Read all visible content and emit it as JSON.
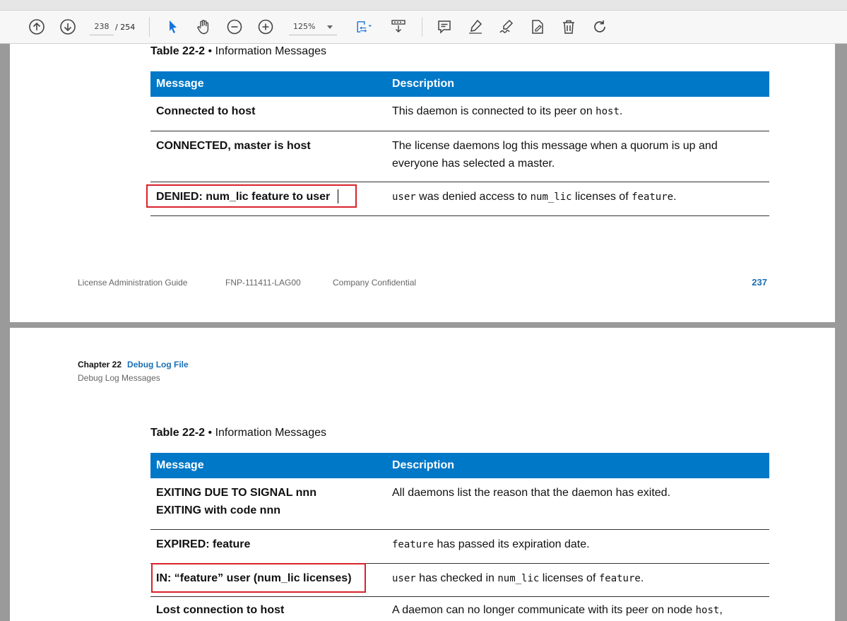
{
  "toolbar": {
    "current_page": "238",
    "total_pages": "/ 254",
    "zoom": "125%",
    "icons": [
      "prev-page-icon",
      "next-page-icon",
      "select-cursor-icon",
      "hand-tool-icon",
      "zoom-out-icon",
      "zoom-in-icon",
      "fit-page-icon",
      "scroll-mode-icon",
      "comment-icon",
      "highlight-icon",
      "sign-icon",
      "fill-sign-icon",
      "delete-icon",
      "rotate-icon"
    ],
    "colors": {
      "accent": "#1a73d9"
    }
  },
  "page1": {
    "caption_bold": "Table 22-2",
    "caption_rest": "• Information Messages",
    "header": {
      "message": "Message",
      "description": "Description"
    },
    "rows": [
      {
        "message": "Connected to host",
        "description": [
          "This daemon is connected to its peer on ",
          "host",
          "."
        ]
      },
      {
        "message": "CONNECTED, master is host",
        "description_line1": "The license daemons log this message when a quorum is up and",
        "description_line2": "everyone has selected a master."
      },
      {
        "message": "DENIED: num_lic feature to user",
        "description": [
          "user",
          " was denied access to ",
          "num_lic",
          " licenses of ",
          "feature",
          "."
        ]
      }
    ],
    "footer": {
      "guide": "License Administration Guide",
      "doc_id": "FNP-111411-LAG00",
      "confidential": "Company Confidential",
      "page_number": "237"
    }
  },
  "page2": {
    "chapter_label": "Chapter 22",
    "chapter_title": "Debug Log File",
    "section": "Debug Log Messages",
    "caption_bold": "Table 22-2",
    "caption_rest": "• Information Messages",
    "header": {
      "message": "Message",
      "description": "Description"
    },
    "rows": [
      {
        "message_line1": "EXITING DUE TO SIGNAL nnn",
        "message_line2": "EXITING with code nnn",
        "description": "All daemons list the reason that the daemon has exited."
      },
      {
        "message": "EXPIRED: feature",
        "description": [
          "feature",
          " has passed its expiration date."
        ]
      },
      {
        "message": "IN: “feature” user (num_lic licenses)",
        "description": [
          "user",
          " has checked in ",
          "num_lic",
          " licenses of ",
          "feature",
          "."
        ]
      },
      {
        "message": "Lost connection to host",
        "description": [
          "A daemon can no longer communicate with its peer on node ",
          "host",
          ","
        ]
      }
    ]
  },
  "colors": {
    "table_header": "#0078c8",
    "highlight_box": "#d9222a",
    "link": "#1a6fb5"
  }
}
